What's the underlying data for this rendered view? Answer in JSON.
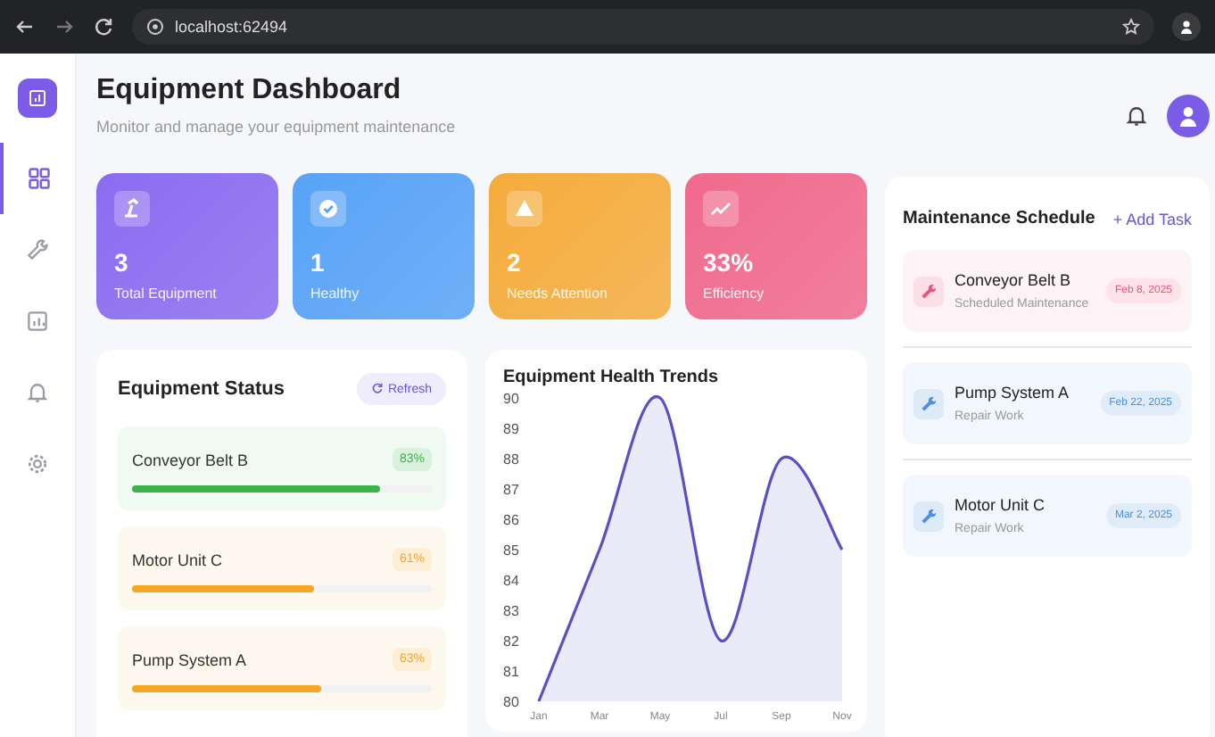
{
  "browser": {
    "url": "localhost:62494"
  },
  "sidebar": {
    "items": [
      {
        "selected": true
      },
      {
        "selected": false
      },
      {
        "selected": false
      },
      {
        "selected": false
      },
      {
        "selected": false
      }
    ]
  },
  "header": {
    "title": "Equipment Dashboard",
    "subtitle": "Monitor and manage your equipment maintenance"
  },
  "stats": [
    {
      "value": "3",
      "label": "Total Equipment",
      "color": "#8b6cf0"
    },
    {
      "value": "1",
      "label": "Healthy",
      "color": "#58a3f7"
    },
    {
      "value": "2",
      "label": "Needs Attention",
      "color": "#f5ac3c"
    },
    {
      "value": "33%",
      "label": "Efficiency",
      "color": "#f06a8c"
    }
  ],
  "equipment_status": {
    "title": "Equipment Status",
    "refresh": "Refresh",
    "items": [
      {
        "name": "Conveyor Belt B",
        "reading": "83%",
        "level": 0.83,
        "color": "#3cb44b"
      },
      {
        "name": "Motor Unit C",
        "reading": "61%",
        "level": 0.61,
        "color": "#f5a623"
      },
      {
        "name": "Pump System A",
        "reading": "63%",
        "level": 0.63,
        "color": "#f5a623"
      }
    ]
  },
  "health_trends": {
    "title": "Equipment Health Trends",
    "chart_data": {
      "type": "area",
      "categories": [
        "Jan",
        "Mar",
        "May",
        "Jul",
        "Sep",
        "Nov"
      ],
      "series": [
        {
          "color": "#5b4fc4",
          "values": [
            80,
            85,
            90,
            82,
            88,
            85
          ]
        }
      ],
      "ylim": [
        80,
        90
      ],
      "yticks": [
        80,
        81,
        82,
        83,
        84,
        85,
        86,
        87,
        88,
        89,
        90
      ]
    }
  },
  "maintenance_schedule": {
    "title": "Maintenance Schedule",
    "add": "+ Add Task",
    "tasks": [
      {
        "name": "Conveyor Belt B",
        "type": "Scheduled Maintenance",
        "date": "Feb 8, 2025",
        "color": "#e8557a"
      },
      {
        "name": "Pump System A",
        "type": "Repair Work",
        "date": "Feb 22, 2025",
        "color": "#4a90e2"
      },
      {
        "name": "Motor Unit C",
        "type": "Repair Work",
        "date": "Mar 2, 2025",
        "color": "#4a90e2"
      }
    ]
  }
}
